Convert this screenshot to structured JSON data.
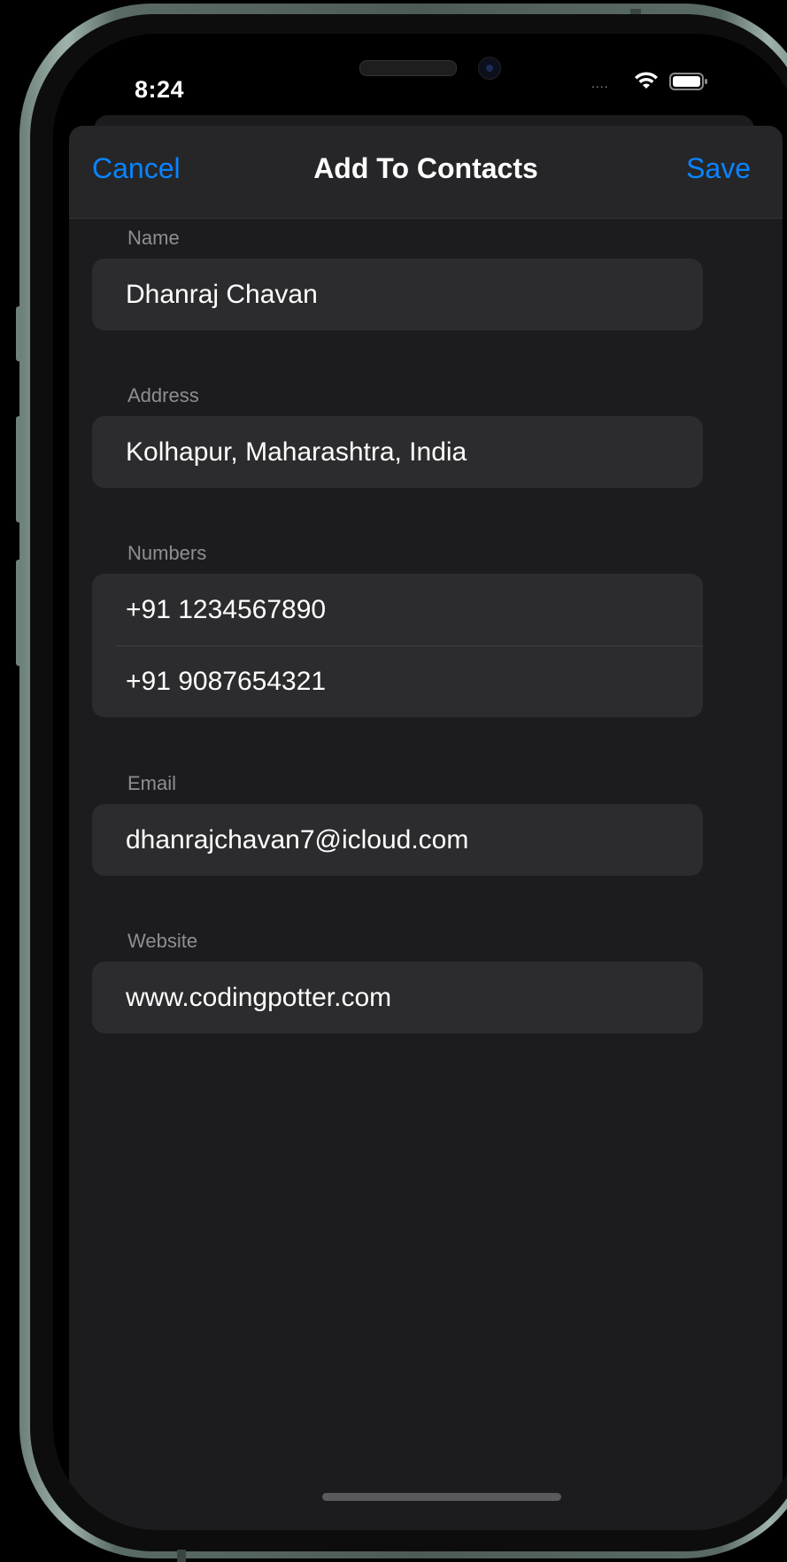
{
  "status_bar": {
    "time": "8:24",
    "signal": "....",
    "icons": [
      "wifi-icon",
      "battery-icon"
    ]
  },
  "nav": {
    "cancel_label": "Cancel",
    "title": "Add To Contacts",
    "save_label": "Save"
  },
  "sections": {
    "name": {
      "header": "Name",
      "values": [
        "Dhanraj Chavan"
      ]
    },
    "address": {
      "header": "Address",
      "values": [
        "Kolhapur, Maharashtra, India"
      ]
    },
    "numbers": {
      "header": "Numbers",
      "values": [
        "+91 1234567890",
        "+91 9087654321"
      ]
    },
    "email": {
      "header": "Email",
      "values": [
        "dhanrajchavan7@icloud.com"
      ]
    },
    "website": {
      "header": "Website",
      "values": [
        "www.codingpotter.com"
      ]
    }
  },
  "colors": {
    "accent": "#0a84ff",
    "sheet_background": "#1c1c1e",
    "field_background": "#2c2c2e",
    "header_text": "#8e8e93"
  }
}
